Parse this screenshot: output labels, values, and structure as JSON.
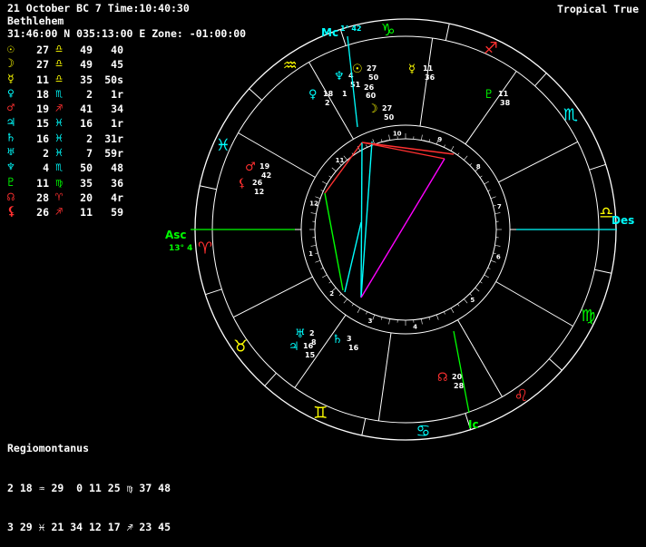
{
  "header": {
    "line1": "21 October BC 7 Time:10:40:30",
    "line2": "Bethlehem",
    "line3": "31:46:00 N 035:13:00 E Zone: -01:00:00",
    "zodiac_mode": "Tropical True"
  },
  "planets": [
    {
      "glyph": "☉",
      "color": "#ffff00",
      "deg": "27",
      "sign": "♎",
      "sign_color": "#ffff00",
      "min": "49",
      "sec": "40"
    },
    {
      "glyph": "☽",
      "color": "#ffff00",
      "deg": "27",
      "sign": "♎",
      "sign_color": "#ffff00",
      "min": "49",
      "sec": "45"
    },
    {
      "glyph": "☿",
      "color": "#ffff00",
      "deg": "11",
      "sign": "♎",
      "sign_color": "#ffff00",
      "min": "35",
      "sec": "50s"
    },
    {
      "glyph": "♀",
      "color": "#00ffff",
      "deg": "18",
      "sign": "♏",
      "sign_color": "#00ffff",
      "min": "2",
      "sec": "1r"
    },
    {
      "glyph": "♂",
      "color": "#ff3030",
      "deg": "19",
      "sign": "♐",
      "sign_color": "#ff3030",
      "min": "41",
      "sec": "34"
    },
    {
      "glyph": "♃",
      "color": "#00ffff",
      "deg": "15",
      "sign": "♓",
      "sign_color": "#00ffff",
      "min": "16",
      "sec": "1r"
    },
    {
      "glyph": "♄",
      "color": "#00ffff",
      "deg": "16",
      "sign": "♓",
      "sign_color": "#00ffff",
      "min": "2",
      "sec": "31r"
    },
    {
      "glyph": "♅",
      "color": "#00ffff",
      "deg": "2",
      "sign": "♓",
      "sign_color": "#00ffff",
      "min": "7",
      "sec": "59r"
    },
    {
      "glyph": "♆",
      "color": "#00ffff",
      "deg": "4",
      "sign": "♏",
      "sign_color": "#00ffff",
      "min": "50",
      "sec": "48"
    },
    {
      "glyph": "♇",
      "color": "#00ff00",
      "deg": "11",
      "sign": "♍",
      "sign_color": "#00ff00",
      "min": "35",
      "sec": "36"
    },
    {
      "glyph": "☊",
      "color": "#ff3030",
      "deg": "28",
      "sign": "♈",
      "sign_color": "#ff3030",
      "min": "20",
      "sec": "4r"
    },
    {
      "glyph": "⚸",
      "color": "#ff3030",
      "deg": "26",
      "sign": "♐",
      "sign_color": "#ff3030",
      "min": "11",
      "sec": "59"
    }
  ],
  "house_system": {
    "title": "Regiomontanus",
    "row1": "2 18 ♒ 29  0 11 25 ♍ 37 48",
    "row2": "3 29 ♓ 21 34 12 17 ♐ 23 45"
  },
  "chart_labels": {
    "mc": "Mc",
    "mc_deg": "1° 42",
    "asc": "Asc",
    "asc_deg": "13° 4",
    "des": "Des",
    "ic": "Ic"
  },
  "zodiac_signs": [
    {
      "glyph": "♈",
      "color": "#ff3030"
    },
    {
      "glyph": "♉",
      "color": "#ffff00"
    },
    {
      "glyph": "♊",
      "color": "#ffff00"
    },
    {
      "glyph": "♋",
      "color": "#00ffff"
    },
    {
      "glyph": "♌",
      "color": "#ff3030"
    },
    {
      "glyph": "♍",
      "color": "#00ff00"
    },
    {
      "glyph": "♎",
      "color": "#ffff00"
    },
    {
      "glyph": "♏",
      "color": "#00ffff"
    },
    {
      "glyph": "♐",
      "color": "#ff3030"
    },
    {
      "glyph": "♑",
      "color": "#00ff00"
    },
    {
      "glyph": "♒",
      "color": "#ffff00"
    },
    {
      "glyph": "♓",
      "color": "#00ffff"
    }
  ],
  "house_numbers": [
    "1",
    "2",
    "3",
    "4",
    "5",
    "6",
    "7",
    "8",
    "9",
    "10",
    "11",
    "12"
  ],
  "planet_labels": [
    {
      "name": "sun",
      "glyph": "☉",
      "color": "#ffff00",
      "d": "27",
      "m": "50"
    },
    {
      "name": "moon",
      "glyph": "☽",
      "color": "#ffff00",
      "d": "27",
      "m": "50"
    },
    {
      "name": "mercury",
      "glyph": "☿",
      "color": "#ffff00",
      "d": "11",
      "m": "36"
    },
    {
      "name": "venus",
      "glyph": "♀",
      "color": "#00ffff",
      "d": "18",
      "m": "2"
    },
    {
      "name": "mars",
      "glyph": "♂",
      "color": "#ff3030",
      "d": "19",
      "m": "42"
    },
    {
      "name": "chiron",
      "glyph": "⚸",
      "color": "#ff3030",
      "d": "26",
      "m": "12"
    },
    {
      "name": "pluto",
      "glyph": "♇",
      "color": "#00ff00",
      "d": "11",
      "m": "38"
    },
    {
      "name": "neptune",
      "glyph": "♆",
      "color": "#00ffff",
      "d": "4",
      "m": "51"
    },
    {
      "name": "node",
      "glyph": "☊",
      "color": "#ff3030",
      "d": "20",
      "m": "28"
    },
    {
      "name": "jupiter",
      "glyph": "♃",
      "color": "#00ffff",
      "d": "16",
      "m": "15"
    },
    {
      "name": "saturn",
      "glyph": "♄",
      "color": "#00ffff",
      "d": "3",
      "m": "16"
    },
    {
      "name": "uranus",
      "glyph": "♅",
      "color": "#00ffff",
      "d": "2",
      "m": "8"
    }
  ],
  "small_degree_labels": {
    "a": "26",
    "b": "50",
    "c": "60",
    "d": "1"
  },
  "aspect_colors": {
    "square": "#ff3030",
    "trine": "#00ff00",
    "sextile": "#00ffff",
    "opposition": "#ff00ff"
  }
}
